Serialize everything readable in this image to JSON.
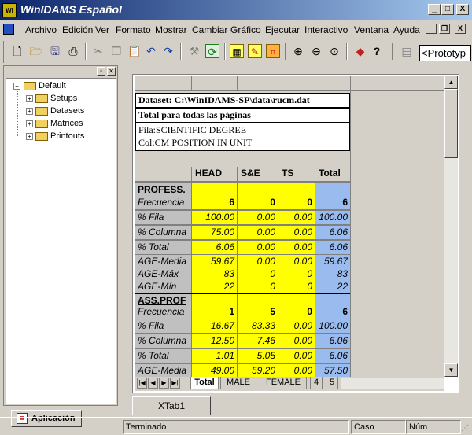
{
  "app": {
    "title": "WinIDAMS Español",
    "icon_text": "WI",
    "window_controls": [
      "_",
      "□",
      "X"
    ]
  },
  "menubar": {
    "items": [
      "Archivo",
      "Edición",
      "Ver",
      "Formato",
      "Mostrar",
      "Cambiar",
      "Gráfico",
      "Ejecutar",
      "Interactivo",
      "Ventana",
      "Ayuda"
    ],
    "mdi_controls": [
      "_",
      "❐",
      "X"
    ]
  },
  "toolbar": {
    "combo_value": "<Prototyp"
  },
  "tree": {
    "root": "Default",
    "children": [
      "Setups",
      "Datasets",
      "Matrices",
      "Printouts"
    ]
  },
  "app_tab": {
    "label": "Aplicación"
  },
  "table": {
    "dataset_line": "Dataset: C:\\WinIDAMS-SP\\data\\rucm.dat",
    "pages_line": "Total para todas las páginas",
    "row_var": "Fila:SCIENTIFIC DEGREE",
    "col_var": "Col:CM POSITION IN UNIT",
    "columns": [
      "HEAD",
      "S&E",
      "TS",
      "Total"
    ],
    "groups": [
      {
        "name": "PROFESS.",
        "rows": [
          {
            "label": "Frecuencia",
            "values": [
              "6",
              "0",
              "0",
              "6"
            ]
          },
          {
            "label": "% Fila",
            "values": [
              "100.00",
              "0.00",
              "0.00",
              "100.00"
            ]
          },
          {
            "label": "% Columna",
            "values": [
              "75.00",
              "0.00",
              "0.00",
              "6.06"
            ]
          },
          {
            "label": "% Total",
            "values": [
              "6.06",
              "0.00",
              "0.00",
              "6.06"
            ]
          },
          {
            "label": "AGE-Media",
            "values": [
              "59.67",
              "0.00",
              "0.00",
              "59.67"
            ]
          },
          {
            "label": "AGE-Máx",
            "values": [
              "83",
              "0",
              "0",
              "83"
            ]
          },
          {
            "label": "AGE-Mín",
            "values": [
              "22",
              "0",
              "0",
              "22"
            ]
          }
        ]
      },
      {
        "name": "ASS.PROF",
        "rows": [
          {
            "label": "Frecuencia",
            "values": [
              "1",
              "5",
              "0",
              "6"
            ]
          },
          {
            "label": "% Fila",
            "values": [
              "16.67",
              "83.33",
              "0.00",
              "100.00"
            ]
          },
          {
            "label": "% Columna",
            "values": [
              "12.50",
              "7.46",
              "0.00",
              "6.06"
            ]
          },
          {
            "label": "% Total",
            "values": [
              "1.01",
              "5.05",
              "0.00",
              "6.06"
            ]
          },
          {
            "label": "AGE-Media",
            "values": [
              "49.00",
              "59.20",
              "0.00",
              "57.50"
            ]
          }
        ]
      }
    ]
  },
  "sheet_tabs": [
    "Total",
    "MALE",
    "FEMALE",
    "4",
    "5"
  ],
  "doc_tab": {
    "label": "XTab1"
  },
  "status": {
    "text": "Terminado",
    "caso": "Caso",
    "num": "Núm"
  },
  "colors": {
    "yellow_cells": "#ffff00",
    "blue_total": "#99bbee",
    "titlebar": "#0a246a"
  }
}
